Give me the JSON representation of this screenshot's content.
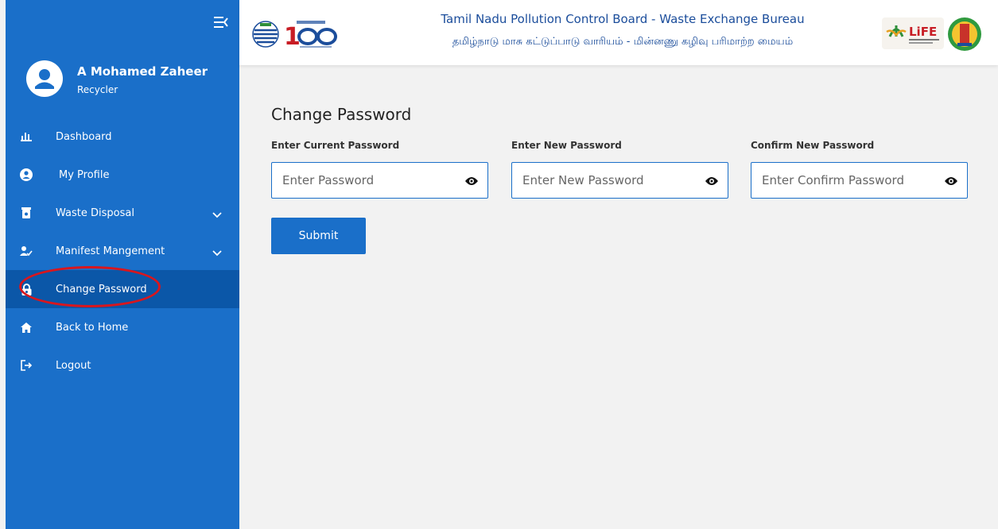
{
  "sidebar": {
    "user": {
      "name": "A Mohamed Zaheer",
      "role": "Recycler"
    },
    "items": [
      {
        "label": "Dashboard",
        "icon": "bar-chart-icon"
      },
      {
        "label": "My Profile",
        "icon": "user-circle-icon"
      },
      {
        "label": "Waste Disposal",
        "icon": "trash-bin-icon",
        "expandable": true
      },
      {
        "label": "Manifest Mangement",
        "icon": "user-check-icon",
        "expandable": true
      },
      {
        "label": "Change Password",
        "icon": "lock-icon",
        "active": true
      },
      {
        "label": "Back to Home",
        "icon": "home-icon"
      },
      {
        "label": "Logout",
        "icon": "logout-icon"
      }
    ]
  },
  "header": {
    "title_en": "Tamil Nadu Pollution Control Board - Waste Exchange Bureau",
    "title_ta": "தமிழ்நாடு மாசு கட்டுப்பாடு வாரியம் - மின்னணு கழிவு பரிமாற்ற மையம்"
  },
  "form": {
    "title": "Change Password",
    "fields": [
      {
        "label": "Enter Current Password",
        "placeholder": "Enter Password"
      },
      {
        "label": "Enter New Password",
        "placeholder": "Enter New Password"
      },
      {
        "label": "Confirm New Password",
        "placeholder": "Enter Confirm Password"
      }
    ],
    "submit_label": "Submit"
  },
  "colors": {
    "sidebar_bg": "#1a6fc9",
    "sidebar_active": "#0b57a8",
    "title_blue": "#1b4d9b",
    "highlight": "#d9161d"
  }
}
